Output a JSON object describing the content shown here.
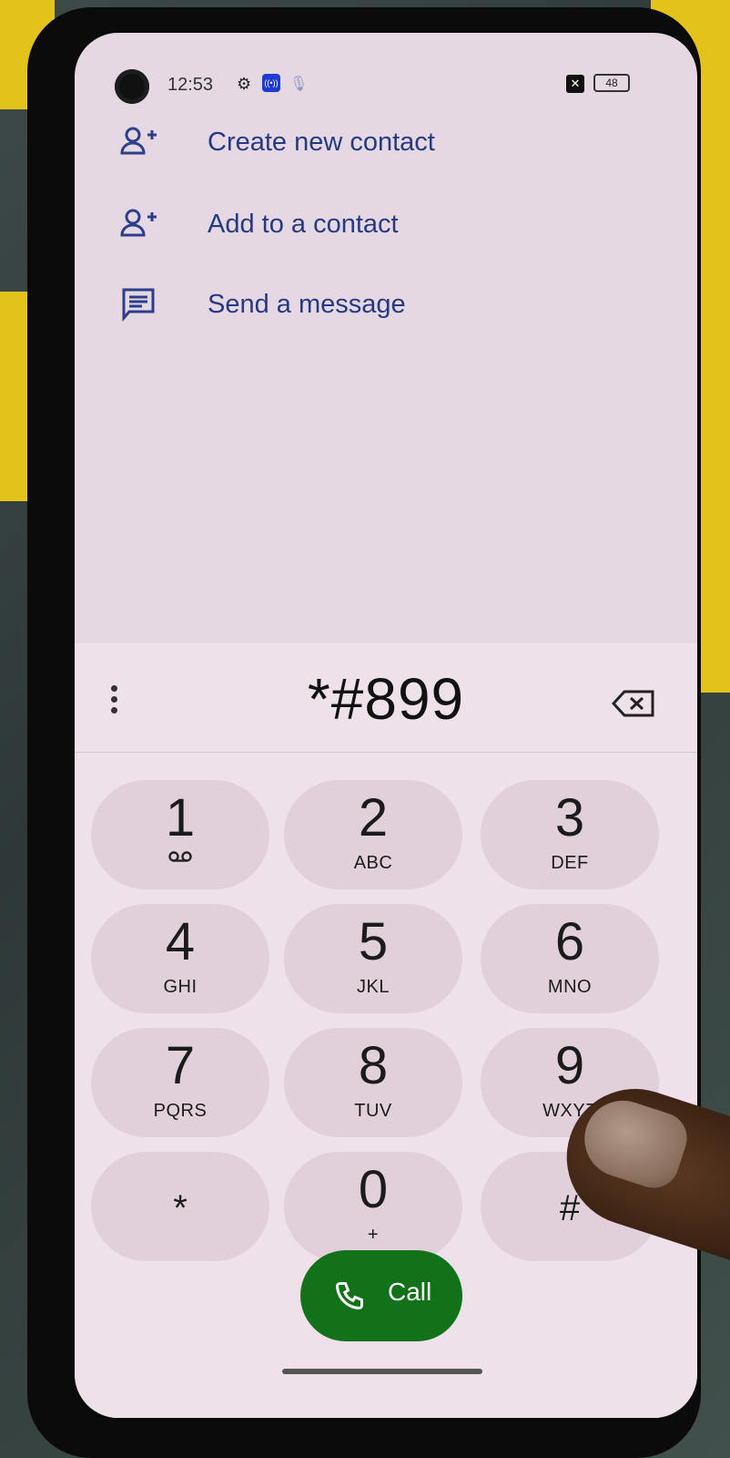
{
  "status_bar": {
    "time": "12:53",
    "battery": "48"
  },
  "actions": [
    {
      "label": "Create new contact",
      "icon": "person-add-icon"
    },
    {
      "label": "Add to a contact",
      "icon": "person-add-icon"
    },
    {
      "label": "Send a message",
      "icon": "message-icon"
    }
  ],
  "dialer": {
    "number": "*#899",
    "keys": [
      {
        "digit": "1",
        "letters": ""
      },
      {
        "digit": "2",
        "letters": "ABC"
      },
      {
        "digit": "3",
        "letters": "DEF"
      },
      {
        "digit": "4",
        "letters": "GHI"
      },
      {
        "digit": "5",
        "letters": "JKL"
      },
      {
        "digit": "6",
        "letters": "MNO"
      },
      {
        "digit": "7",
        "letters": "PQRS"
      },
      {
        "digit": "8",
        "letters": "TUV"
      },
      {
        "digit": "9",
        "letters": "WXYZ"
      },
      {
        "digit": "*",
        "letters": ""
      },
      {
        "digit": "0",
        "letters": "+"
      },
      {
        "digit": "#",
        "letters": ""
      }
    ],
    "call_label": "Call"
  },
  "colors": {
    "accent_text": "#253a86",
    "call_button": "#12721a",
    "screen_bg": "#e6d8e2",
    "key_bg": "#e1d0da"
  }
}
